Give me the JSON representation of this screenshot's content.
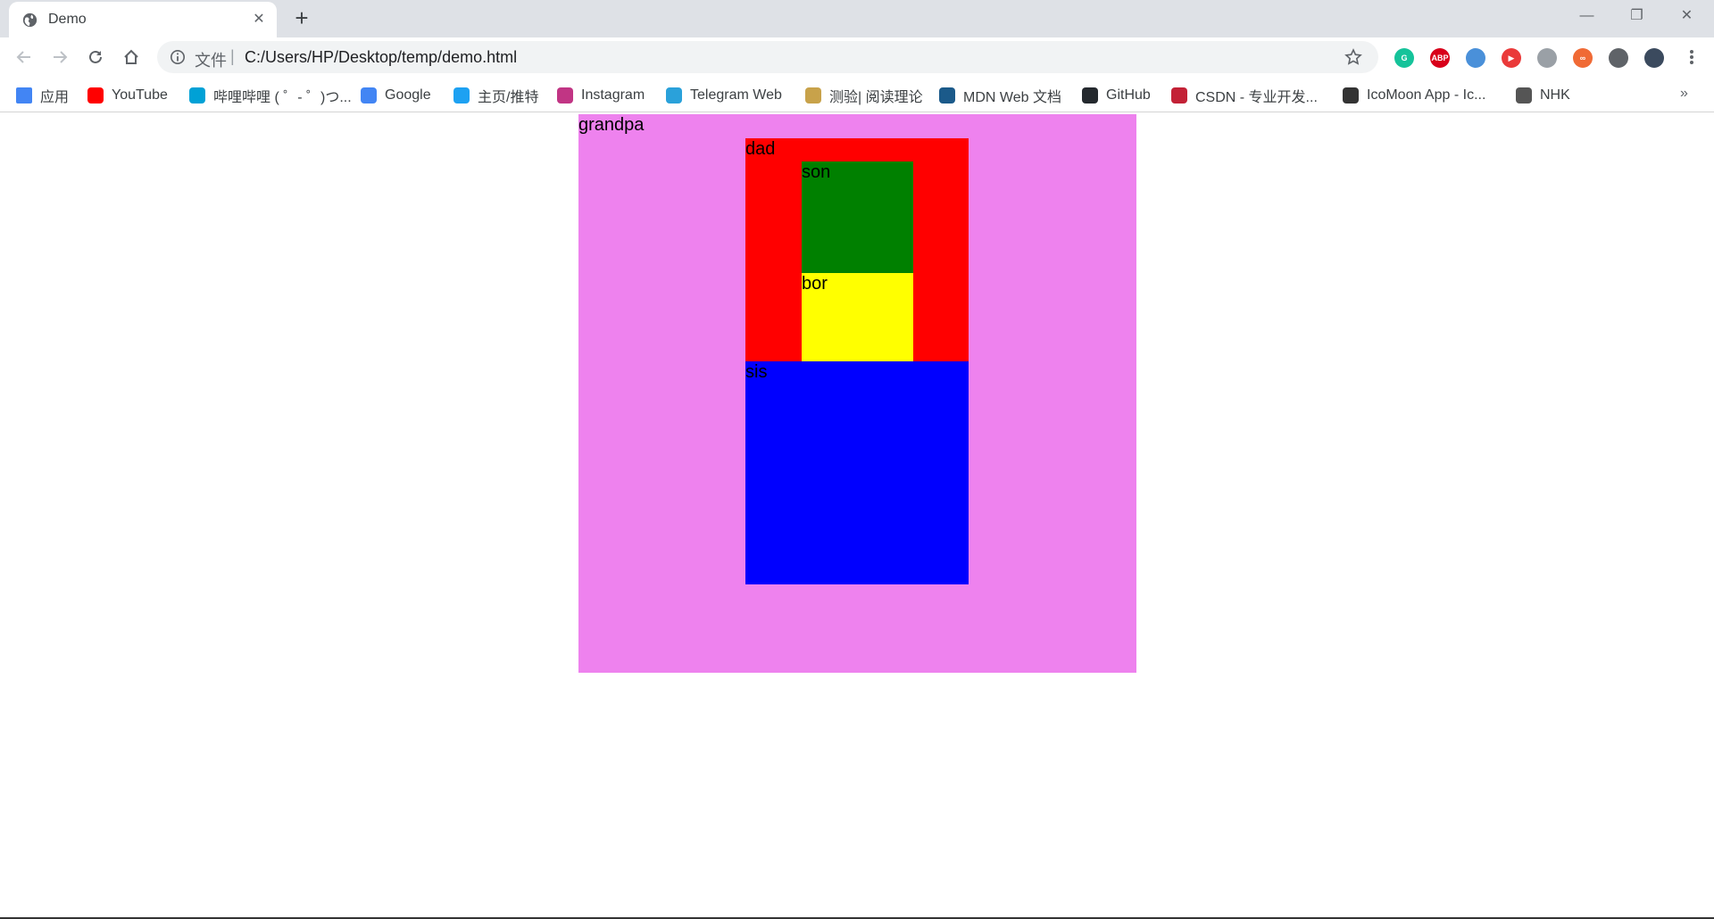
{
  "tab": {
    "title": "Demo",
    "close": "✕",
    "new_tab": "+"
  },
  "window": {
    "minimize": "—",
    "maximize": "❐",
    "close": "✕"
  },
  "address": {
    "scheme_label": "文件",
    "separator": "|",
    "url": "C:/Users/HP/Desktop/temp/demo.html"
  },
  "bookmarks": [
    {
      "label": "应用",
      "icon": "apps-grid-icon"
    },
    {
      "label": "YouTube",
      "icon": "youtube-icon"
    },
    {
      "label": "哔哩哔哩 ( ゜- ゜)つ...",
      "icon": "bilibili-icon"
    },
    {
      "label": "Google",
      "icon": "google-icon"
    },
    {
      "label": "主页/推特",
      "icon": "twitter-icon"
    },
    {
      "label": "Instagram",
      "icon": "instagram-icon"
    },
    {
      "label": "Telegram Web",
      "icon": "telegram-icon"
    },
    {
      "label": "测验| 阅读理论",
      "icon": "folder-books-icon"
    },
    {
      "label": "MDN Web 文档",
      "icon": "mdn-icon"
    },
    {
      "label": "GitHub",
      "icon": "github-icon"
    },
    {
      "label": "CSDN - 专业开发...",
      "icon": "csdn-icon"
    },
    {
      "label": "IcoMoon App - Ic...",
      "icon": "icomoon-icon"
    },
    {
      "label": "NHK",
      "icon": "nhk-icon"
    }
  ],
  "bookmarks_more": "»",
  "extensions": [
    {
      "name": "grammarly-icon",
      "color": "#15c39a",
      "text": "G"
    },
    {
      "name": "adblock-plus-icon",
      "color": "#d8001a",
      "text": "ABP"
    },
    {
      "name": "extension-grid-icon",
      "color": "#4a90d9",
      "text": ""
    },
    {
      "name": "media-icon",
      "color": "#ea3a3a",
      "text": "▶"
    },
    {
      "name": "wallet-icon",
      "color": "#9aa0a6",
      "text": ""
    },
    {
      "name": "infinity-icon",
      "color": "#f06a35",
      "text": "∞"
    },
    {
      "name": "puzzle-icon",
      "color": "#5f6368",
      "text": ""
    },
    {
      "name": "profile-avatar-icon",
      "color": "#3b4a5e",
      "text": ""
    }
  ],
  "boxes": {
    "grandpa": {
      "label": "grandpa",
      "color": "#ee82ee"
    },
    "dad": {
      "label": "dad",
      "color": "#ff0000"
    },
    "son": {
      "label": "son",
      "color": "#008000"
    },
    "bor": {
      "label": "bor",
      "color": "#ffff00"
    },
    "sis": {
      "label": "sis",
      "color": "#0000ff"
    }
  }
}
